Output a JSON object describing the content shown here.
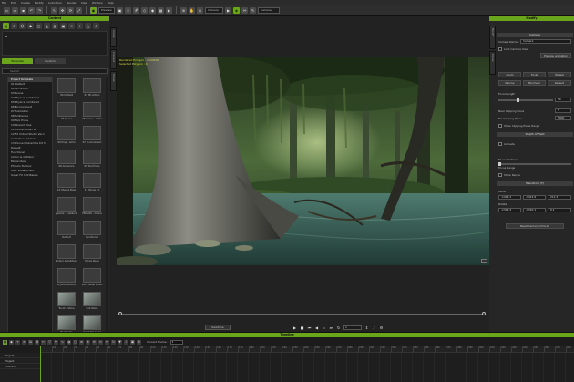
{
  "menubar": {
    "items": [
      "File",
      "Edit",
      "Create",
      "Modify",
      "Animation",
      "Render",
      "View",
      "Window",
      "Help"
    ]
  },
  "toolbar": {
    "camera_select": "Preview",
    "render_select": "Camera",
    "search_placeholder": "Search",
    "status_text": "Camera"
  },
  "left_panel": {
    "title": "Content",
    "breadcrumb": "⌂",
    "tabs": [
      "Template",
      "Custom"
    ],
    "search_placeholder": "Search",
    "tree": [
      "Project Template",
      "01 Default",
      "02 3D Action",
      "03 Scene",
      "04 Physics Combined",
      "05 Physics Combined",
      "06 Environment",
      "07 Animation",
      "08 Ambience",
      "09 Tool Props",
      "10 Shared Pose",
      "11 iClone Mode File",
      "12 FX Virtual Studio Ver.1",
      "Animation, Camera",
      "13 iClone Interactive Kit 3",
      "Default",
      "Functional",
      "Indoor & Outdoor",
      "Movie Ideas",
      "Physics Toolbox",
      "Shift Visual Effect",
      "Super FX 100 Basics"
    ],
    "grid": [
      {
        "label": "3D Default"
      },
      {
        "label": "03 3D Action"
      },
      {
        "label": "04 Scene"
      },
      {
        "label": "05 Scene - Ambi"
      },
      {
        "label": "06 Prop - Ambi"
      },
      {
        "label": "07 Environment"
      },
      {
        "label": "08 Ambience"
      },
      {
        "label": "09 Tool Props"
      },
      {
        "label": "10 Shared Pose"
      },
      {
        "label": "11 iClone Int"
      },
      {
        "label": "Special - Lowlands"
      },
      {
        "label": "PROLOG - iClone"
      },
      {
        "label": "Default"
      },
      {
        "label": "Functional"
      },
      {
        "label": "Indoor & Outdoor"
      },
      {
        "label": "Movie Ideas"
      },
      {
        "label": "Physics Toolbox"
      },
      {
        "label": "SUPI Visual Effect"
      },
      {
        "label": "Touch - Shine"
      },
      {
        "label": "Sub Items"
      },
      {
        "label": "Backyards"
      },
      {
        "label": "Crocodile Lever"
      }
    ]
  },
  "side_tabs": [
    "Scene",
    "Content",
    "Visual"
  ],
  "viewport": {
    "info_lines": [
      "Rendered Polygon : 1203400",
      "Selected Polygon : 0"
    ]
  },
  "playback": {
    "realtime_label": "Realtime",
    "frame_value": "1"
  },
  "right_panel": {
    "title": "Modify",
    "tabs": [
      "Modify",
      "Visual"
    ],
    "camera_section": "Camera",
    "camera_name_label": "Camera Name :",
    "camera_name_value": "Camera",
    "lock_camera_label": "Lock Camera View",
    "preview_btn": "Preview animation",
    "lens_buttons": [
      "Zoom",
      "Focal",
      "Widest",
      "Narrow",
      "Minimum",
      "Default"
    ],
    "focal_length_label": "Focal Length",
    "focal_length_value": "50",
    "near_clip_label": "Near Clipping Plane",
    "near_clip_value": "5",
    "far_clip_label": "Far Clipping Plane",
    "far_clip_value": "5000",
    "show_clip_label": "Show Clipping Plane Range",
    "dof_section": "Depth of Field",
    "dof_enable_label": "Activate",
    "focus_distance_label": "Focus Distance",
    "focus_range_label": "Focus Range",
    "show_range_label": "Show Range",
    "transform_section": "Transform (T)",
    "move_label": "Move",
    "move_values": [
      "-1404.2",
      "-1412.6",
      "211.3"
    ],
    "rotate_label": "Rotate",
    "rotate_values": [
      "-1304.2",
      "-1310.1",
      "0.1"
    ],
    "reset_btn": "Reset Camera (Ctrl+R)"
  },
  "timeline": {
    "title": "Timeline",
    "current_frame_label": "Current Frame :",
    "current_frame_value": "1",
    "tracks": [
      "Project",
      "Project",
      "Switcher"
    ],
    "ruler_numbers": [
      "10",
      "20",
      "30",
      "40",
      "50",
      "60",
      "70",
      "80",
      "90",
      "100",
      "110",
      "120",
      "130",
      "140",
      "150",
      "160",
      "170",
      "180",
      "190",
      "200",
      "210",
      "220",
      "230",
      "240",
      "250",
      "260",
      "270",
      "280",
      "290",
      "300",
      "310",
      "320",
      "330",
      "340",
      "350",
      "360",
      "370",
      "380",
      "390",
      "400",
      "410",
      "420",
      "430",
      "440",
      "450",
      "460",
      "470",
      "480"
    ]
  }
}
